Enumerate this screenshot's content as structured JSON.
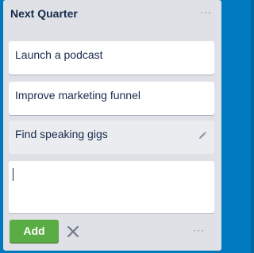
{
  "list": {
    "title": "Next Quarter",
    "menu_glyph": "···"
  },
  "cards": [
    {
      "text": "Launch a podcast"
    },
    {
      "text": "Improve marketing funnel"
    },
    {
      "text": "Find speaking gigs",
      "icon": "pencil-icon"
    }
  ],
  "composer": {
    "value": ""
  },
  "actions": {
    "add_label": "Add",
    "close_icon": "close-icon",
    "menu_glyph": "···"
  },
  "colors": {
    "board": "#0079bf",
    "list_bg": "#dfe1e6",
    "add_button": "#5aac44",
    "text": "#172b4d"
  }
}
